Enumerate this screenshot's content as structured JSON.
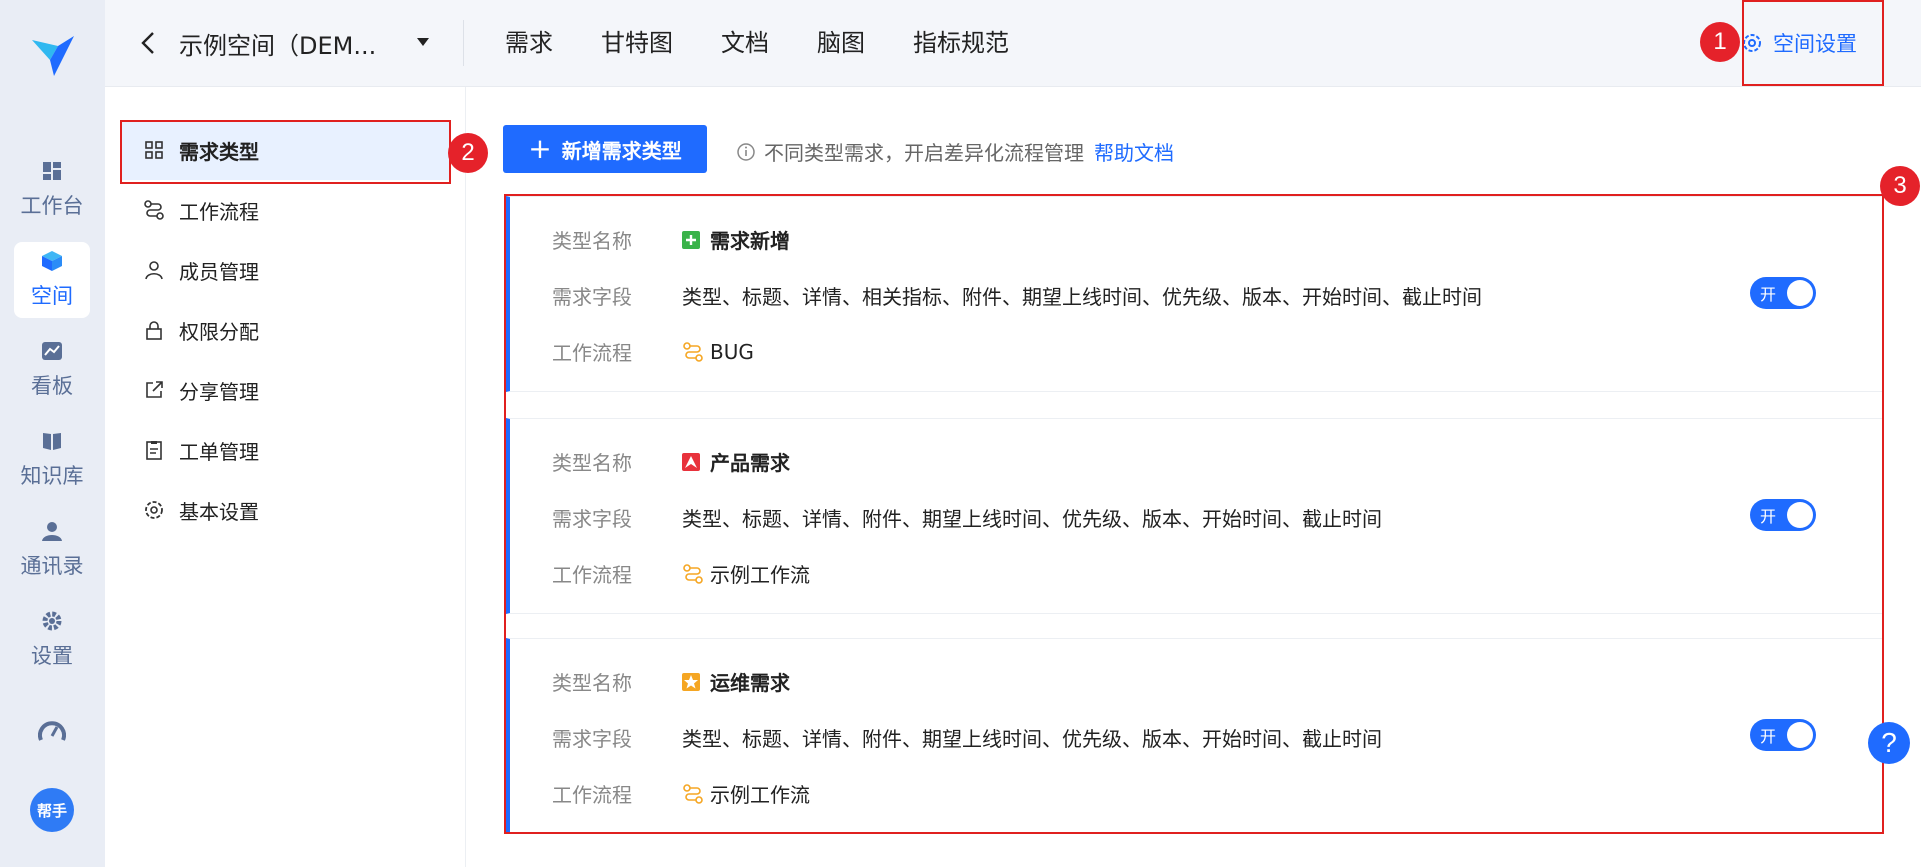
{
  "rail": {
    "items": [
      {
        "label": "工作台",
        "icon": "dashboard-icon"
      },
      {
        "label": "空间",
        "icon": "cube-icon",
        "active": true
      },
      {
        "label": "看板",
        "icon": "chart-board-icon"
      },
      {
        "label": "知识库",
        "icon": "book-icon"
      },
      {
        "label": "通讯录",
        "icon": "contacts-icon"
      },
      {
        "label": "设置",
        "icon": "gear-icon"
      }
    ],
    "helper_label": "帮手"
  },
  "topbar": {
    "space_name": "示例空间（DEM...",
    "tabs": [
      "需求",
      "甘特图",
      "文档",
      "脑图",
      "指标规范"
    ],
    "space_settings": "空间设置"
  },
  "markers": [
    "1",
    "2",
    "3"
  ],
  "subnav": {
    "items": [
      {
        "label": "需求类型",
        "icon": "grid-icon",
        "active": true
      },
      {
        "label": "工作流程",
        "icon": "workflow-icon"
      },
      {
        "label": "成员管理",
        "icon": "user-icon"
      },
      {
        "label": "权限分配",
        "icon": "lock-icon"
      },
      {
        "label": "分享管理",
        "icon": "share-icon"
      },
      {
        "label": "工单管理",
        "icon": "clipboard-icon"
      },
      {
        "label": "基本设置",
        "icon": "gear-icon"
      }
    ]
  },
  "main": {
    "add_button": "新增需求类型",
    "hint_text": "不同类型需求，开启差异化流程管理",
    "help_link": "帮助文档",
    "labels": {
      "type_name": "类型名称",
      "fields": "需求字段",
      "workflow": "工作流程"
    },
    "cards": [
      {
        "name": "需求新增",
        "badge_color": "#3ab34a",
        "badge_icon": "plus-badge-icon",
        "fields": "类型、标题、详情、相关指标、附件、期望上线时间、优先级、版本、开始时间、截止时间",
        "workflow": "BUG",
        "toggle": "开"
      },
      {
        "name": "产品需求",
        "badge_color": "#e8323c",
        "badge_icon": "triangle-badge-icon",
        "fields": "类型、标题、详情、附件、期望上线时间、优先级、版本、开始时间、截止时间",
        "workflow": "示例工作流",
        "toggle": "开"
      },
      {
        "name": "运维需求",
        "badge_color": "#f5a623",
        "badge_icon": "star-badge-icon",
        "fields": "类型、标题、详情、附件、期望上线时间、优先级、版本、开始时间、截止时间",
        "workflow": "示例工作流",
        "toggle": "开"
      }
    ]
  },
  "help_fab": "?"
}
